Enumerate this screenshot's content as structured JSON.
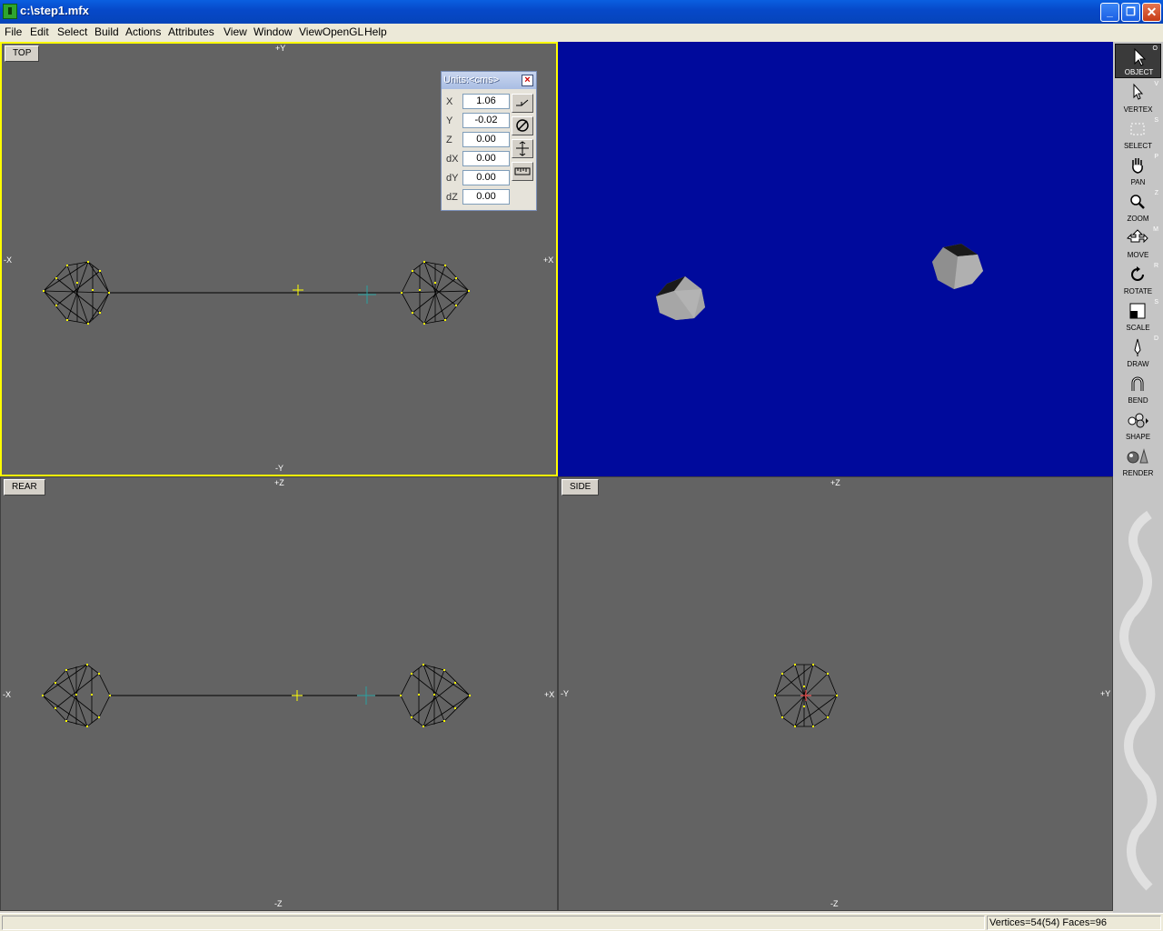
{
  "window": {
    "title": "c:\\step1.mfx",
    "minimize": "_",
    "restore": "❐",
    "close": "✕"
  },
  "menu": [
    "File",
    "Edit",
    "Select",
    "Build",
    "Actions",
    "Attributes",
    "View",
    "Window",
    "ViewOpenGL",
    "Help"
  ],
  "viewports": {
    "top": {
      "label": "TOP",
      "axis_top": "+Y",
      "axis_bottom": "-Y",
      "axis_left": "-X",
      "axis_right": "+X"
    },
    "rear": {
      "label": "REAR",
      "axis_top": "+Z",
      "axis_bottom": "-Z",
      "axis_left": "-X",
      "axis_right": "+X"
    },
    "side": {
      "label": "SIDE",
      "axis_top": "+Z",
      "axis_bottom": "-Z",
      "axis_left": "-Y",
      "axis_right": "+Y"
    },
    "perspective": {
      "background": "#000a9c"
    }
  },
  "units_panel": {
    "title": "Units:<cms>",
    "rows": [
      {
        "label": "X",
        "value": "1.06"
      },
      {
        "label": "Y",
        "value": "-0.02"
      },
      {
        "label": "Z",
        "value": "0.00"
      },
      {
        "label": "dX",
        "value": "0.00"
      },
      {
        "label": "dY",
        "value": "0.00"
      },
      {
        "label": "dZ",
        "value": "0.00"
      }
    ],
    "buttons": [
      "snap-icon",
      "no-constraint-icon",
      "scale-arrows-icon",
      "ruler-icon"
    ]
  },
  "tools": [
    {
      "label": "OBJECT",
      "key": "O",
      "icon": "object-arrow-icon",
      "active": true
    },
    {
      "label": "VERTEX",
      "key": "V",
      "icon": "vertex-arrow-icon"
    },
    {
      "label": "SELECT",
      "key": "S",
      "icon": "select-rect-icon"
    },
    {
      "label": "PAN",
      "key": "P",
      "icon": "hand-icon"
    },
    {
      "label": "ZOOM",
      "key": "Z",
      "icon": "magnifier-icon"
    },
    {
      "label": "MOVE",
      "key": "M",
      "icon": "move-arrows-icon"
    },
    {
      "label": "ROTATE",
      "key": "R",
      "icon": "rotate-icon"
    },
    {
      "label": "SCALE",
      "key": "S",
      "icon": "scale-icon"
    },
    {
      "label": "DRAW",
      "key": "D",
      "icon": "pen-icon"
    },
    {
      "label": "BEND",
      "key": "",
      "icon": "bend-icon"
    },
    {
      "label": "SHAPE",
      "key": "",
      "icon": "shape-icon"
    },
    {
      "label": "RENDER",
      "key": "",
      "icon": "render-icon"
    }
  ],
  "status": {
    "text": "Vertices=54(54) Faces=96"
  },
  "colors": {
    "viewport_bg": "#636363",
    "active_viewport_border": "#ffff00",
    "vertex": "#ffff00",
    "wire": "#000000",
    "perspective_bg": "#000a9c"
  }
}
